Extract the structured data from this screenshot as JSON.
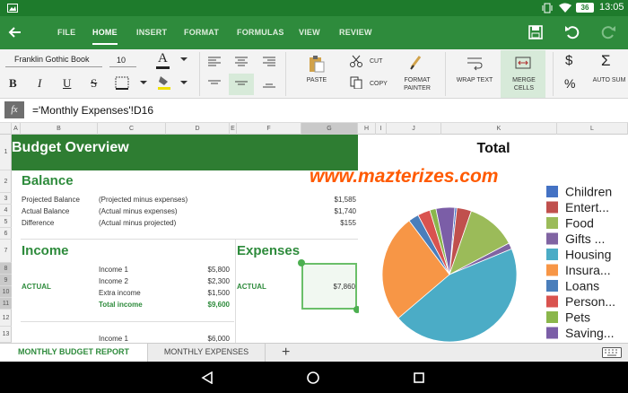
{
  "status": {
    "battery": "36",
    "time": "13:05"
  },
  "menu_tabs": [
    "FILE",
    "HOME",
    "INSERT",
    "FORMAT",
    "FORMULAS",
    "VIEW",
    "REVIEW"
  ],
  "toolbar": {
    "font_name": "Franklin Gothic Book",
    "font_size": "10",
    "paste": "PASTE",
    "cut": "CUT",
    "copy": "COPY",
    "format_painter_1": "FORMAT",
    "format_painter_2": "PAINTER",
    "wrap_text": "WRAP TEXT",
    "merge_1": "MERGE",
    "merge_2": "CELLS",
    "autosum": "AUTO SUM",
    "bold": "B",
    "italic": "I",
    "underline": "U",
    "strike": "S",
    "font_color_glyph": "A",
    "dollar": "$",
    "percent": "%",
    "sigma": "Σ"
  },
  "formula": {
    "fx": "fx",
    "text": "='Monthly Expenses'!D16"
  },
  "columns": [
    "A",
    "B",
    "C",
    "D",
    "E",
    "F",
    "G",
    "H",
    "I",
    "J",
    "K",
    "L"
  ],
  "rows": [
    "1",
    "2",
    "3",
    "4",
    "5",
    "6",
    "7",
    "8",
    "9",
    "10",
    "11",
    "12",
    "13"
  ],
  "sheet": {
    "title": "Budget Overview",
    "balance": {
      "heading": "Balance",
      "rows": [
        {
          "label": "Projected Balance",
          "desc": "(Projected  minus expenses)",
          "value": "$1,585"
        },
        {
          "label": "Actual Balance",
          "desc": "(Actual  minus expenses)",
          "value": "$1,740"
        },
        {
          "label": "Difference",
          "desc": "(Actual minus projected)",
          "value": "$155"
        }
      ]
    },
    "income": {
      "heading": "Income",
      "actual": "ACTUAL",
      "rows": [
        {
          "label": "Income 1",
          "value": "$5,800"
        },
        {
          "label": "Income 2",
          "value": "$2,300"
        },
        {
          "label": "Extra income",
          "value": "$1,500"
        },
        {
          "label": "Total income",
          "value": "$9,600"
        }
      ],
      "next_row": {
        "label": "Income 1",
        "value": "$6,000"
      }
    },
    "expenses": {
      "heading": "Expenses",
      "actual": "ACTUAL",
      "value": "$7,860"
    }
  },
  "watermark": "www.mazterizes.com",
  "chart_data": {
    "type": "pie",
    "title": "Total",
    "categories": [
      "Children",
      "Entert...",
      "Food",
      "Gifts ...",
      "Housing",
      "Insura...",
      "Loans",
      "Person...",
      "Pets",
      "Saving..."
    ],
    "values": [
      0.5,
      3.5,
      12,
      1.5,
      45,
      26,
      2.5,
      3,
      1.5,
      4.5
    ],
    "colors": [
      "#4472c4",
      "#c0504d",
      "#9bbb59",
      "#8064a2",
      "#4bacc6",
      "#f79646",
      "#4a7ebb",
      "#d9534f",
      "#8ab64b",
      "#7b5ea7"
    ],
    "legend_position": "right"
  },
  "sheet_tabs": [
    "MONTHLY BUDGET REPORT",
    "MONTHLY EXPENSES"
  ],
  "add_sheet": "+"
}
